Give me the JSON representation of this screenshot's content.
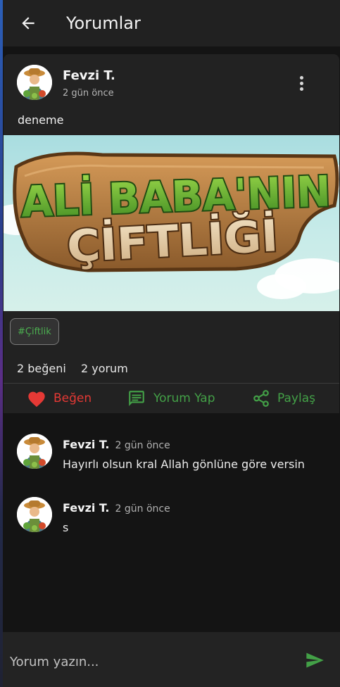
{
  "header": {
    "title": "Yorumlar",
    "back_icon": "arrow-left-icon"
  },
  "post": {
    "author": "Fevzi T.",
    "time": "2 gün önce",
    "text": "deneme",
    "image_title_line1": "ALİ BABA'NIN",
    "image_title_line2": "ÇİFTLİĞİ",
    "hashtag": "#Çiftlik",
    "likes": "2 beğeni",
    "comments_count": "2 yorum",
    "more_icon": "more-vertical-icon"
  },
  "actions": {
    "like": "Beğen",
    "comment": "Yorum Yap",
    "share": "Paylaş"
  },
  "comments": [
    {
      "author": "Fevzi T.",
      "time": "2 gün önce",
      "text": "Hayırlı olsun kral Allah gönlüne göre versin"
    },
    {
      "author": "Fevzi T.",
      "time": "2 gün önce",
      "text": "s"
    }
  ],
  "input": {
    "placeholder": "Yorum yazın...",
    "value": ""
  },
  "colors": {
    "background": "#141414",
    "card": "#222222",
    "app_bar": "#212121",
    "like_red": "#e53935",
    "accent_green": "#43a047"
  }
}
